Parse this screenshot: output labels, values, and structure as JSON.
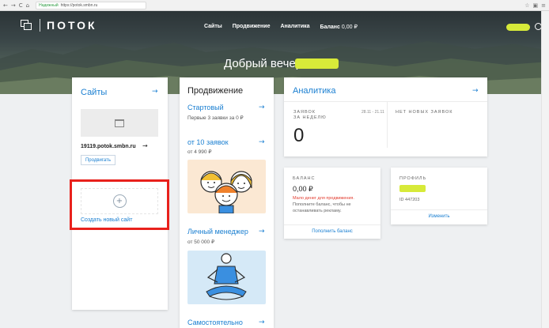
{
  "browser": {
    "nav_icons": [
      "←",
      "→",
      "C",
      "⌂"
    ],
    "secure_label": "Надежный",
    "url": "https://potok.smbn.ru",
    "right_icons": [
      "☆",
      "▣",
      "≡"
    ]
  },
  "header": {
    "logo_text": "ПОТОК",
    "menu": [
      {
        "label": "Сайты"
      },
      {
        "label": "Продвижение"
      },
      {
        "label": "Аналитика"
      }
    ],
    "balance_label": "Баланс",
    "balance_value": "0,00 ₽",
    "greeting": "Добрый вечер,"
  },
  "sites": {
    "title": "Сайты",
    "arrow": "→",
    "domain": "19119.potok.smbn.ru",
    "domain_arrow": "→",
    "promote_button": "Продвигать",
    "plus": "+",
    "create_label": "Создать новый сайт"
  },
  "promotion": {
    "title": "Продвижение",
    "items": [
      {
        "title": "Стартовый",
        "sub": "Первые 3 заявки за 0 ₽",
        "arrow": "→"
      },
      {
        "title": "от 10 заявок",
        "sub": "от 4 990 ₽",
        "arrow": "→"
      },
      {
        "title": "Личный менеджер",
        "sub": "от 50 000 ₽",
        "arrow": "→"
      },
      {
        "title": "Самостоятельно",
        "sub": "",
        "arrow": "→"
      }
    ]
  },
  "analytics": {
    "title": "Аналитика",
    "arrow": "→",
    "leads_label_1": "ЗАЯВОК",
    "leads_label_2": "ЗА НЕДЕЛЮ",
    "dates": "28.11 - 21.11",
    "leads_count": "0",
    "no_new_label": "НЕТ НОВЫХ ЗАЯВОК"
  },
  "balance": {
    "label": "БАЛАНС",
    "value": "0,00 ₽",
    "warning": "Мало денег для продвижения.",
    "note": "Пополните баланс, чтобы не останавливать рекламу.",
    "button": "Пополнить баланс"
  },
  "profile": {
    "label": "ПРОФИЛЬ",
    "id": "ID 447203",
    "button": "Изменить"
  },
  "colors": {
    "accent": "#1a7fd1",
    "highlight": "#e8211c",
    "redacted": "#d7ea39",
    "warning": "#e23b2e"
  }
}
